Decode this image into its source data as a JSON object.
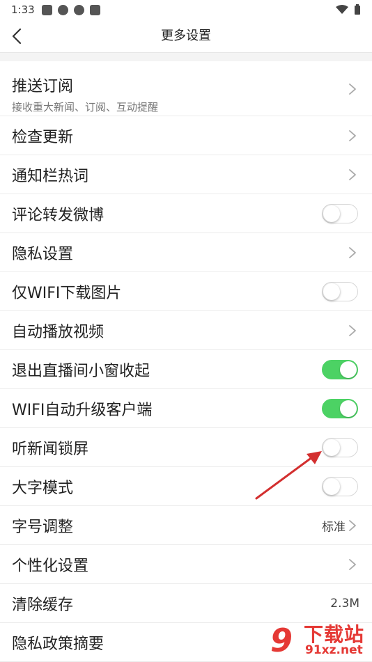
{
  "status_bar": {
    "time": "1:33"
  },
  "header": {
    "title": "更多设置"
  },
  "settings": [
    {
      "key": "push",
      "label": "推送订阅",
      "sub": "接收重大新闻、订阅、互动提醒",
      "type": "chevron"
    },
    {
      "key": "update",
      "label": "检查更新",
      "type": "chevron"
    },
    {
      "key": "hotword",
      "label": "通知栏热词",
      "type": "chevron"
    },
    {
      "key": "weibo",
      "label": "评论转发微博",
      "type": "toggle",
      "on": false
    },
    {
      "key": "privacy",
      "label": "隐私设置",
      "type": "chevron"
    },
    {
      "key": "wifi-image",
      "label": "仅WIFI下载图片",
      "type": "toggle",
      "on": false
    },
    {
      "key": "autoplay",
      "label": "自动播放视频",
      "type": "chevron"
    },
    {
      "key": "live-window",
      "label": "退出直播间小窗收起",
      "type": "toggle",
      "on": true
    },
    {
      "key": "wifi-upgrade",
      "label": "WIFI自动升级客户端",
      "type": "toggle",
      "on": true
    },
    {
      "key": "lockscreen",
      "label": "听新闻锁屏",
      "type": "toggle",
      "on": false
    },
    {
      "key": "big-font",
      "label": "大字模式",
      "type": "toggle",
      "on": false
    },
    {
      "key": "font-size",
      "label": "字号调整",
      "type": "value-chevron",
      "value": "标准"
    },
    {
      "key": "personal",
      "label": "个性化设置",
      "type": "chevron"
    },
    {
      "key": "cache",
      "label": "清除缓存",
      "type": "value",
      "value": "2.3M"
    },
    {
      "key": "policy",
      "label": "隐私政策摘要",
      "type": "none"
    }
  ],
  "watermark": {
    "logo": "9",
    "title": "下载站",
    "domain": "91xz.net"
  },
  "colors": {
    "toggle_on": "#4cd264",
    "arrow": "#d32f2f",
    "watermark": "#e53935"
  }
}
